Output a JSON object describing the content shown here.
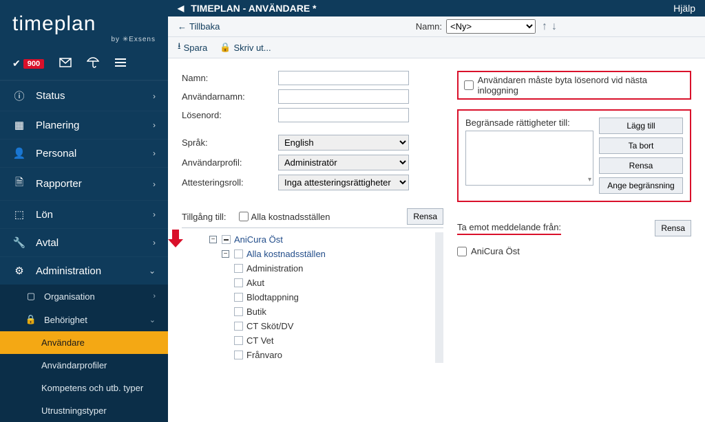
{
  "logo": {
    "brand": "timeplan",
    "byline": "by ✳Exsens"
  },
  "util": {
    "badge": "900"
  },
  "nav": {
    "status": "Status",
    "planering": "Planering",
    "personal": "Personal",
    "rapporter": "Rapporter",
    "lon": "Lön",
    "avtal": "Avtal",
    "administration": "Administration",
    "organisation": "Organisation",
    "behorighet": "Behörighet",
    "anvandare": "Användare",
    "anvandarprofiler": "Användarprofiler",
    "kompetens": "Kompetens och utb. typer",
    "utrustning": "Utrustningstyper"
  },
  "header": {
    "title": "TIMEPLAN - ANVÄNDARE *",
    "help": "Hjälp"
  },
  "toolbar": {
    "back": "Tillbaka",
    "namn_label": "Namn:",
    "namn_select": "<Ny>",
    "spara": "Spara",
    "skriv_ut": "Skriv ut..."
  },
  "form": {
    "namn": "Namn:",
    "anvandarnamn": "Användarnamn:",
    "losenord": "Lösenord:",
    "sprak": "Språk:",
    "sprak_val": "English",
    "profil": "Användarprofil:",
    "profil_val": "Administratör",
    "attest": "Attesteringsroll:",
    "attest_val": "Inga attesteringsrättigheter"
  },
  "right": {
    "force_pw": "Användaren måste byta lösenord vid nästa inloggning",
    "restricted": "Begränsade rättigheter till:",
    "lagg_till": "Lägg till",
    "ta_bort": "Ta bort",
    "rensa": "Rensa",
    "ange": "Ange begränsning"
  },
  "access": {
    "label": "Tillgång till:",
    "alla": "Alla kostnadsställen",
    "rensa": "Rensa"
  },
  "receive": {
    "label": "Ta emot meddelande från:",
    "rensa": "Rensa",
    "item": "AniCura Öst"
  },
  "tree": {
    "root": "AniCura Öst",
    "all_cc": "Alla kostnadsställen",
    "items": [
      "Administration",
      "Akut",
      "Blodtappning",
      "Butik",
      "CT Sköt/DV",
      "CT Vet",
      "Frånvaro"
    ]
  }
}
